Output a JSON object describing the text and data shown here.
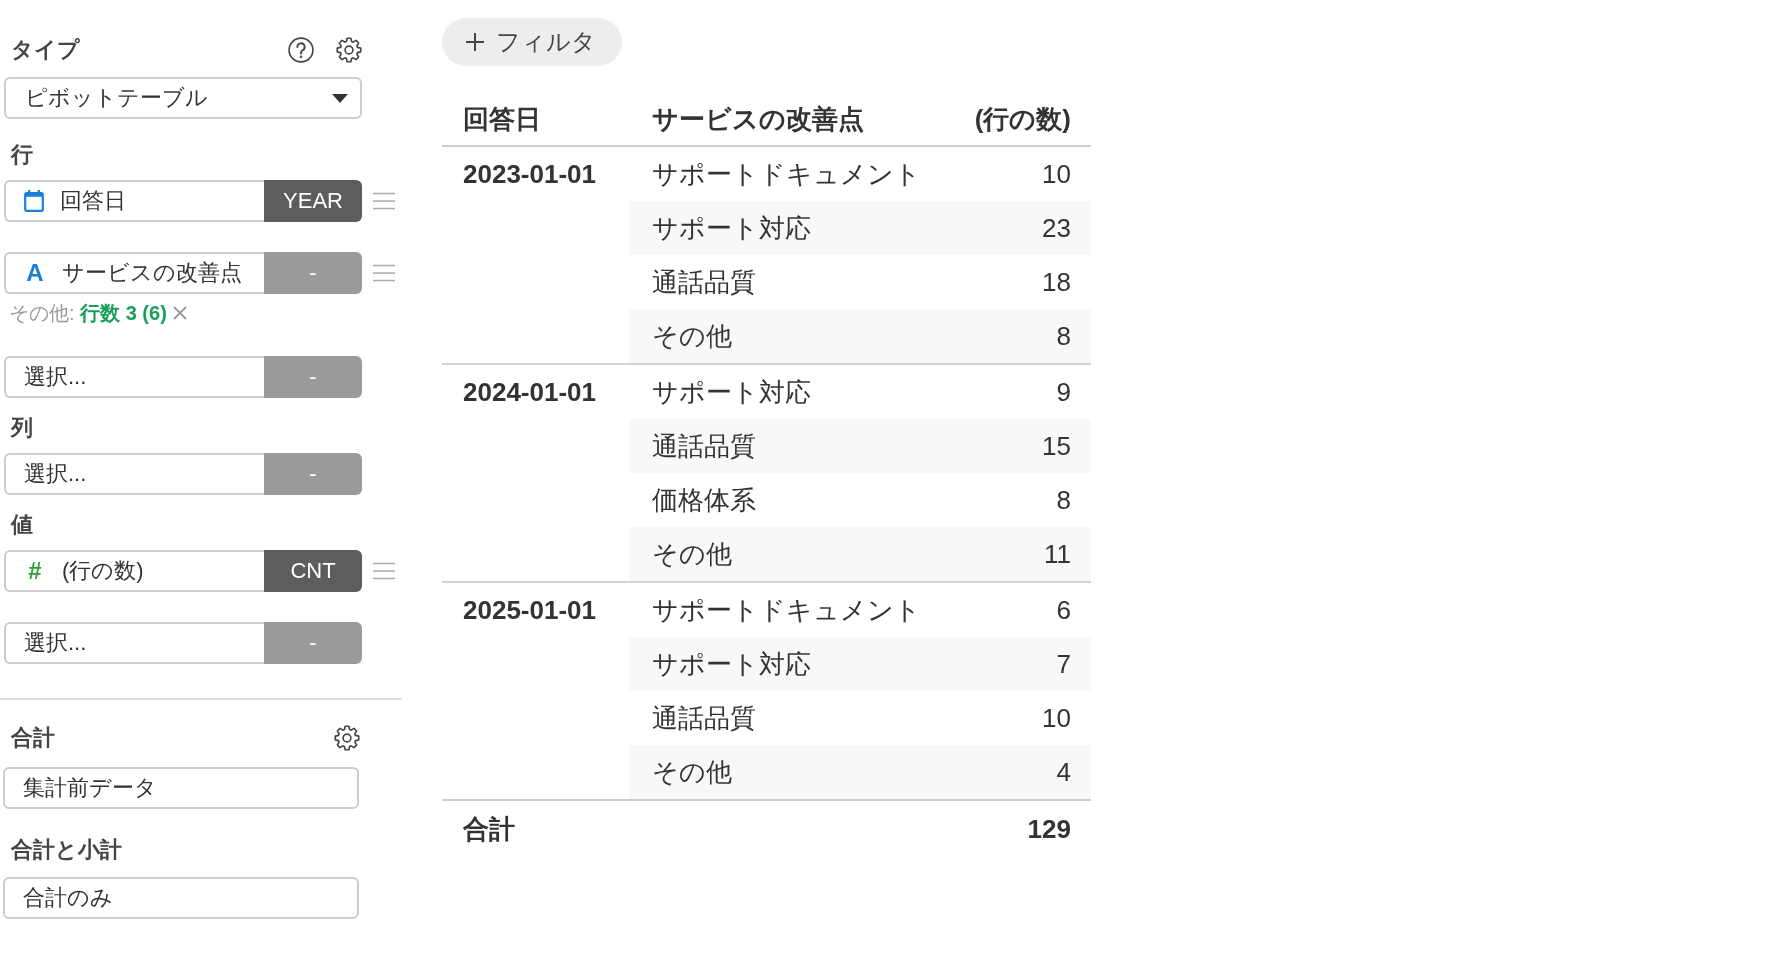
{
  "sidebar": {
    "type_section": {
      "label": "タイプ",
      "value": "ピボットテーブル"
    },
    "rows": {
      "label": "行",
      "fields": [
        {
          "kind": "date",
          "name": "回答日",
          "aggregation": "YEAR",
          "active": true
        },
        {
          "kind": "text",
          "icon": "A",
          "name": "サービスの改善点",
          "aggregation": "-",
          "active": false,
          "note": "その他: **行数 3 (6)**"
        },
        {
          "kind": "empty",
          "placeholder": "選択...",
          "aggregation": "-",
          "active": false
        }
      ]
    },
    "columns": {
      "label": "列",
      "fields": [
        {
          "kind": "empty",
          "placeholder": "選択...",
          "aggregation": "-",
          "active": false
        }
      ]
    },
    "values": {
      "label": "値",
      "fields": [
        {
          "kind": "number",
          "icon": "#",
          "name": "(行の数)",
          "aggregation": "CNT",
          "active": true
        },
        {
          "kind": "empty",
          "placeholder": "選択...",
          "aggregation": "-",
          "active": false
        }
      ]
    },
    "total": {
      "label": "合計",
      "value": "集計前データ"
    },
    "subtotals": {
      "label": "合計と小計",
      "value": "合計のみ"
    }
  },
  "filter_button": {
    "label": "フィルタ"
  },
  "table": {
    "columns": [
      "回答日",
      "サービスの改善点",
      "(行の数)"
    ],
    "groups": [
      {
        "date": "2023-01-01",
        "rows": [
          {
            "category": "サポートドキュメント",
            "count": "10"
          },
          {
            "category": "サポート対応",
            "count": "23"
          },
          {
            "category": "通話品質",
            "count": "18"
          },
          {
            "category": "その他",
            "count": "8"
          }
        ]
      },
      {
        "date": "2024-01-01",
        "rows": [
          {
            "category": "サポート対応",
            "count": "9"
          },
          {
            "category": "通話品質",
            "count": "15"
          },
          {
            "category": "価格体系",
            "count": "8"
          },
          {
            "category": "その他",
            "count": "11"
          }
        ]
      },
      {
        "date": "2025-01-01",
        "rows": [
          {
            "category": "サポートドキュメント",
            "count": "6"
          },
          {
            "category": "サポート対応",
            "count": "7"
          },
          {
            "category": "通話品質",
            "count": "10"
          },
          {
            "category": "その他",
            "count": "4"
          }
        ]
      }
    ],
    "total": {
      "label": "合計",
      "value": "129"
    }
  }
}
